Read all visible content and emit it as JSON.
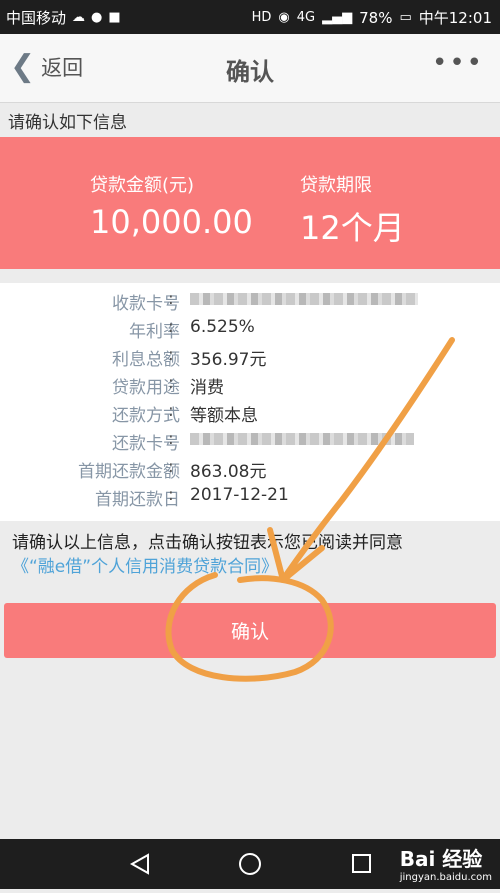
{
  "status_bar": {
    "carrier": "中国移动",
    "battery": "78%",
    "time": "中午12:01",
    "hd": "HD",
    "network": "4G"
  },
  "nav": {
    "back_label": "返回",
    "title": "确认",
    "more_glyph": "•••"
  },
  "prompt": "请确认如下信息",
  "loan": {
    "amount_label": "贷款金额(元)",
    "amount_value": "10,000.00",
    "term_label": "贷款期限",
    "term_value": "12个月"
  },
  "details": {
    "rows": [
      {
        "label": "收款卡号",
        "value": ""
      },
      {
        "label": "年利率",
        "value": "6.525%"
      },
      {
        "label": "利息总额",
        "value": "356.97元"
      },
      {
        "label": "贷款用途",
        "value": "消费"
      },
      {
        "label": "还款方式",
        "value": "等额本息"
      },
      {
        "label": "还款卡号",
        "value": ""
      },
      {
        "label": "首期还款金额",
        "value": "863.08元"
      },
      {
        "label": "首期还款日",
        "value": "2017-12-21"
      }
    ]
  },
  "notice": {
    "text": "请确认以上信息，点击确认按钮表示您已阅读并同意",
    "link": "《“融e借”个人信用消费贷款合同》"
  },
  "confirm_button": "确认",
  "watermark": {
    "brand": "Bai 经验",
    "url": "jingyan.baidu.com"
  },
  "colors": {
    "accent": "#f97b7b",
    "link": "#4fa3d8",
    "annotation": "#f0a046"
  }
}
